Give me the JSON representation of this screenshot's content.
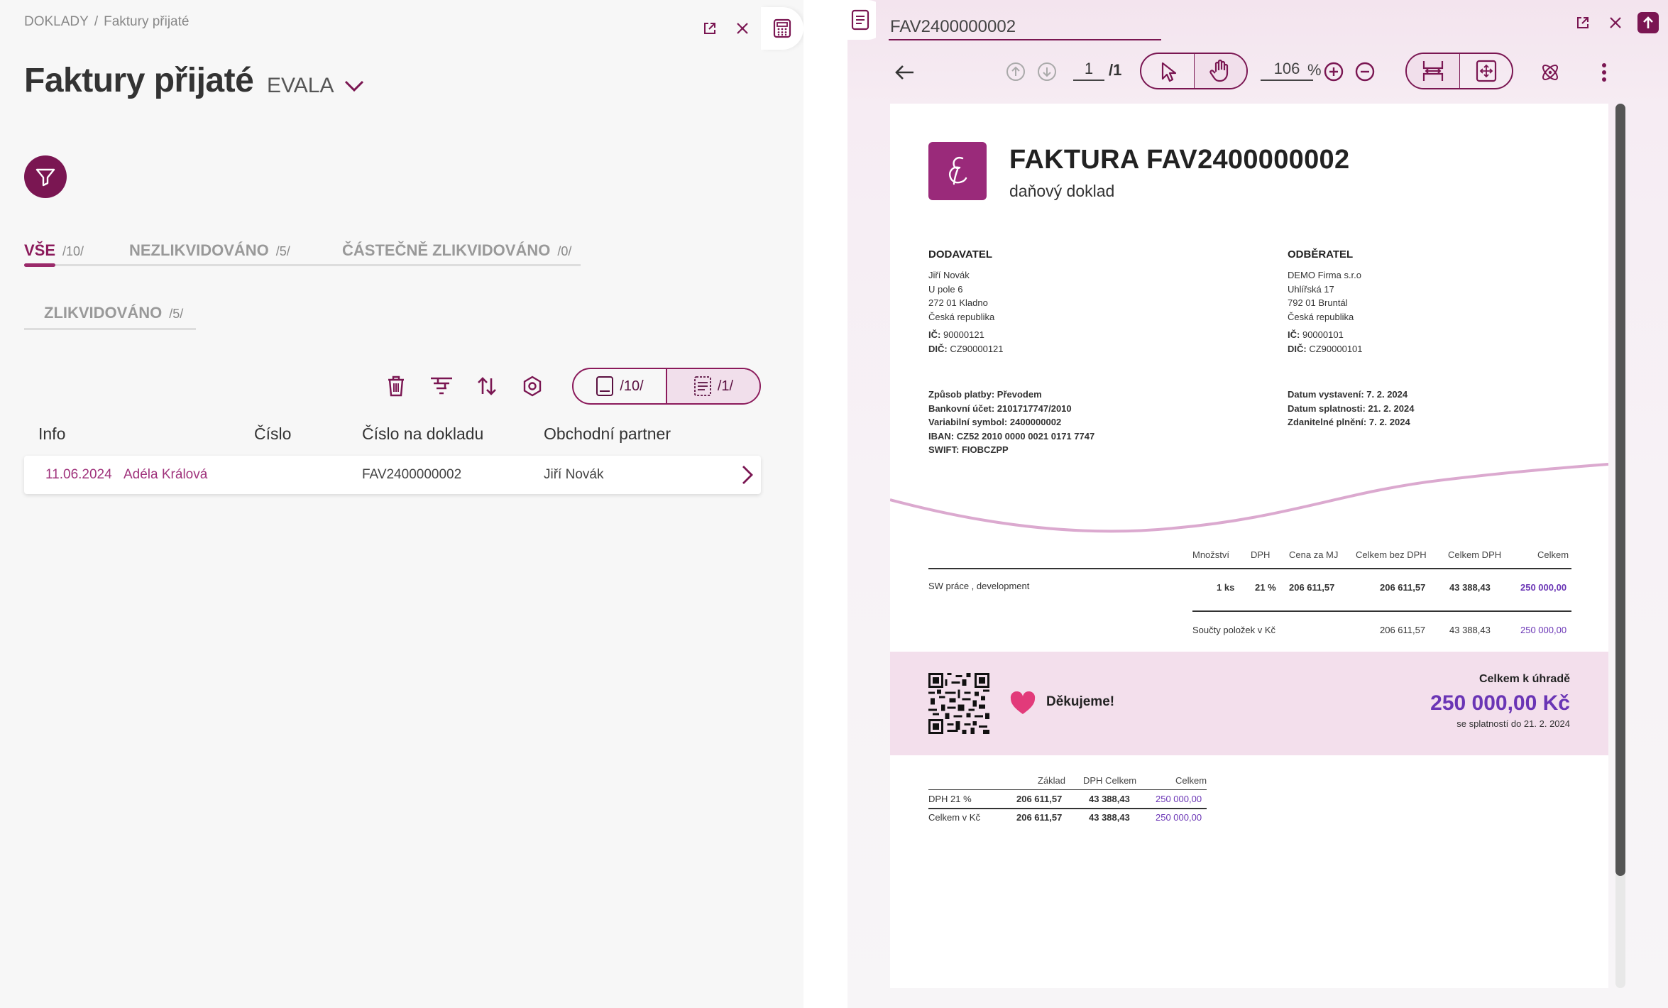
{
  "left": {
    "breadcrumb": {
      "root": "DOKLADY",
      "separator": "/",
      "current": "Faktury přijaté"
    },
    "title": "Faktury přijaté",
    "company": "EVALA",
    "tabs": [
      {
        "label": "VŠE",
        "count": "/10/"
      },
      {
        "label": "NEZLIKVIDOVÁNO",
        "count": "/5/"
      },
      {
        "label": "ČÁSTEČNĚ ZLIKVIDOVÁNO",
        "count": "/0/"
      },
      {
        "label": "ZLIKVIDOVÁNO",
        "count": "/5/"
      }
    ],
    "view_toggle": {
      "all_count": "/10/",
      "selected_count": "/1/"
    },
    "columns": [
      "Info",
      "Číslo",
      "Číslo na dokladu",
      "Obchodní partner"
    ],
    "rows": [
      {
        "date": "11.06.2024",
        "user": "Adéla Králová",
        "number": "",
        "doc_number": "FAV2400000002",
        "partner": "Jiří Novák"
      }
    ]
  },
  "viewer": {
    "title": "FAV2400000002",
    "page": "1",
    "page_total": "/1",
    "zoom": "106",
    "zoom_unit": "%"
  },
  "invoice": {
    "title": "FAKTURA FAV2400000002",
    "subtitle": "daňový doklad",
    "supplier": {
      "heading": "DODAVATEL",
      "name": "Jiří Novák",
      "street": "U pole 6",
      "city": "272 01 Kladno",
      "country": "Česká republika",
      "ic_label": "IČ:",
      "ic": "90000121",
      "dic_label": "DIČ:",
      "dic": "CZ90000121"
    },
    "customer": {
      "heading": "ODBĚRATEL",
      "name": "DEMO Firma s.r.o",
      "street": "Uhlířská 17",
      "city": "792 01 Bruntál",
      "country": "Česká republika",
      "ic_label": "IČ:",
      "ic": "90000101",
      "dic_label": "DIČ:",
      "dic": "CZ90000101"
    },
    "payment": {
      "method_label": "Způsob platby:",
      "method": "Převodem",
      "account_label": "Bankovní účet:",
      "account": "2101717747/2010",
      "vs_label": "Variabilní symbol:",
      "vs": "2400000002",
      "iban_label": "IBAN:",
      "iban": "CZ52 2010 0000 0021 0171 7747",
      "swift_label": "SWIFT:",
      "swift": "FIOBCZPP"
    },
    "dates": {
      "issued_label": "Datum vystavení:",
      "issued": "7. 2. 2024",
      "due_label": "Datum splatnosti:",
      "due": "21. 2. 2024",
      "taxable_label": "Zdanitelné plnění:",
      "taxable": "7. 2. 2024"
    },
    "items_header": [
      "Množství",
      "DPH",
      "Cena za MJ",
      "Celkem bez DPH",
      "Celkem DPH",
      "Celkem"
    ],
    "items": [
      {
        "name": "SW práce , development",
        "qty": "1 ks",
        "vat": "21 %",
        "unit_price": "206 611,57",
        "net": "206 611,57",
        "vat_amount": "43 388,43",
        "total": "250 000,00"
      }
    ],
    "items_sum": {
      "label": "Součty položek v Kč",
      "net": "206 611,57",
      "vat_amount": "43 388,43",
      "total": "250 000,00"
    },
    "thanks": "Děkujeme!",
    "total_label": "Celkem k úhradě",
    "total_value": "250 000,00 Kč",
    "total_due": "se splatností do 21. 2. 2024",
    "vat_header": [
      "Základ",
      "DPH Celkem",
      "Celkem"
    ],
    "vat_rows": [
      {
        "label": "DPH 21 %",
        "base": "206 611,57",
        "vat": "43 388,43",
        "total": "250 000,00"
      },
      {
        "label": "Celkem v Kč",
        "base": "206 611,57",
        "vat": "43 388,43",
        "total": "250 000,00"
      }
    ]
  },
  "colors": {
    "brand": "#7a1652",
    "accent_text": "#a0337c",
    "total_purple": "#6a35b5",
    "band": "#f3dfec"
  }
}
